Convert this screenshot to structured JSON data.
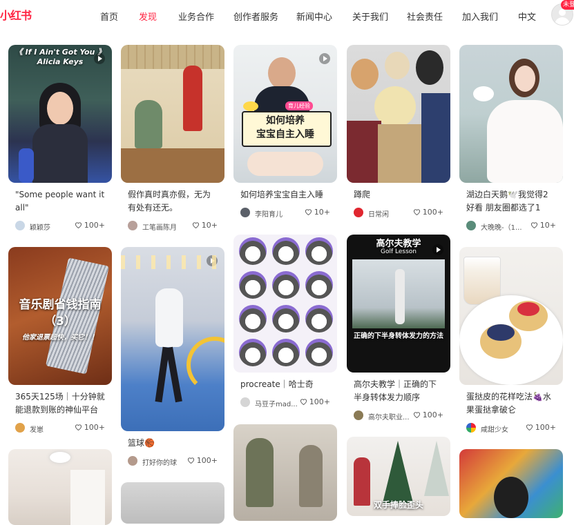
{
  "header": {
    "logo": "小红书",
    "nav": [
      "首页",
      "发现",
      "业务合作",
      "创作者服务",
      "新闻中心",
      "关于我们",
      "社会责任",
      "加入我们",
      "中文"
    ],
    "active_nav": "发现",
    "login_badge": "未登"
  },
  "colors": {
    "accent": "#ff2442"
  },
  "feed": [
    {
      "overlay": "《 If I Ain't Got You 》\nAlicia Keys",
      "title": "\"Some people want it all\"",
      "author": "颖颖莎",
      "likes": "100+",
      "video": true
    },
    {
      "overlay": "",
      "title": "假作真时真亦假，无为有处有还无。",
      "author": "工笔画陈月",
      "likes": "10+",
      "video": true
    },
    {
      "overlay": "如何培养\n宝宝自主入睡",
      "tag": "育儿经验",
      "title": "如何培养宝宝自主入睡",
      "author": "李阳育儿",
      "likes": "10+",
      "video": true
    },
    {
      "overlay": "",
      "title": "蹲爬",
      "author": "日常闲",
      "likes": "100+",
      "video": false
    },
    {
      "overlay": "",
      "title": "湖边白天鹅🕊️我觉得2好看 朋友圈都选了1",
      "author": "大晚晚-（1...",
      "likes": "10+",
      "video": false
    },
    {
      "overlay": "音乐剧省钱指南\n（3）",
      "sub_overlay": "他家退票超快，买它！！",
      "title": "365天125场｜十分钟就能退款到账的神仙平台",
      "author": "发崽",
      "likes": "100+",
      "video": false
    },
    {
      "overlay": "",
      "title": "篮球🏀",
      "author": "打好你的球",
      "likes": "100+",
      "video": true
    },
    {
      "overlay": "",
      "title": "procreate｜哈士奇",
      "author": "马豆子mad...",
      "likes": "100+",
      "video": false
    },
    {
      "overlay": "高尔夫教学",
      "sub_overlay": "Golf Lesson",
      "caption": "正确的下半身转体发力的方法",
      "title": "高尔夫教学｜正确的下半身转体发力顺序",
      "author": "高尔夫职业...",
      "likes": "100+",
      "video": true
    },
    {
      "overlay": "",
      "title": "蛋挞皮的花样吃法🍇水果蛋挞拿破仑",
      "author": "咸甜少女",
      "likes": "100+",
      "video": false
    },
    {
      "overlay": "",
      "title": "",
      "author": "",
      "likes": "",
      "video": false
    },
    {
      "overlay": "",
      "title": "",
      "author": "",
      "likes": "",
      "video": false
    },
    {
      "overlay": "",
      "title": "",
      "author": "",
      "likes": "",
      "video": false
    },
    {
      "overlay": "双手捧脸歪头",
      "title": "",
      "author": "",
      "likes": "",
      "video": false
    },
    {
      "overlay": "",
      "title": "",
      "author": "",
      "likes": "",
      "video": false
    }
  ]
}
